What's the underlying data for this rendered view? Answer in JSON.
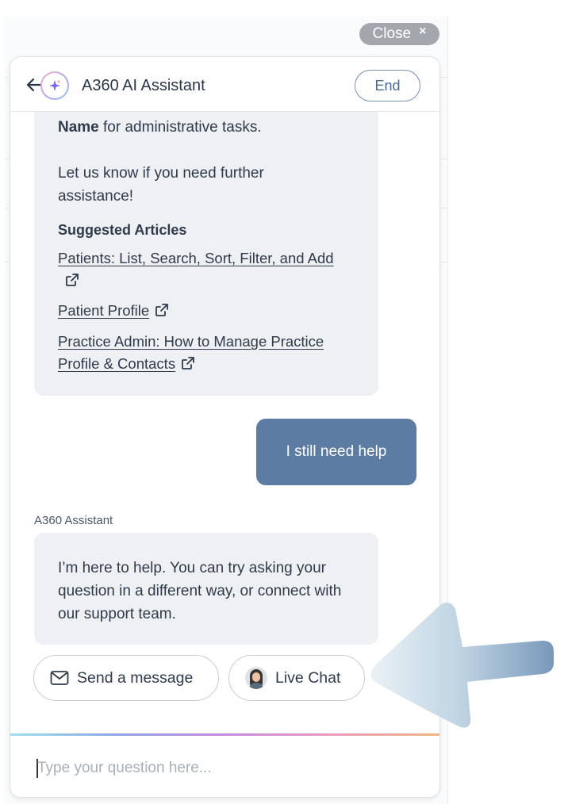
{
  "window": {
    "close_label": "Close",
    "close_icon": "×"
  },
  "header": {
    "title": "A360 AI Assistant",
    "end_label": "End"
  },
  "conversation": {
    "bot_message_1": {
      "bold_term": "Name",
      "line1_rest": " for administrative tasks.",
      "line2": "Let us know if you need further assistance!",
      "suggested_title": "Suggested Articles",
      "articles": [
        {
          "label": "Patients: List, Search, Sort, Filter, and Add"
        },
        {
          "label": "Patient Profile"
        },
        {
          "label": "Practice Admin: How to Manage Practice Profile & Contacts"
        }
      ]
    },
    "user_message": "I still need help",
    "sender_label": "A360 Assistant",
    "bot_message_2": "I’m here to help. You can try asking your question in a different way, or connect with our support team.",
    "actions": {
      "send_message": "Send a message",
      "live_chat": "Live Chat"
    }
  },
  "composer": {
    "placeholder": "Type your question here..."
  },
  "colors": {
    "user_bubble": "#5d7ca3",
    "bot_bubble": "#eef0f3",
    "accent_border": "#7390b4",
    "pointer_arrow": "#8aa9c8"
  },
  "icons": [
    "back-arrow-icon",
    "sparkle-icon",
    "external-link-icon",
    "envelope-icon",
    "close-icon"
  ]
}
